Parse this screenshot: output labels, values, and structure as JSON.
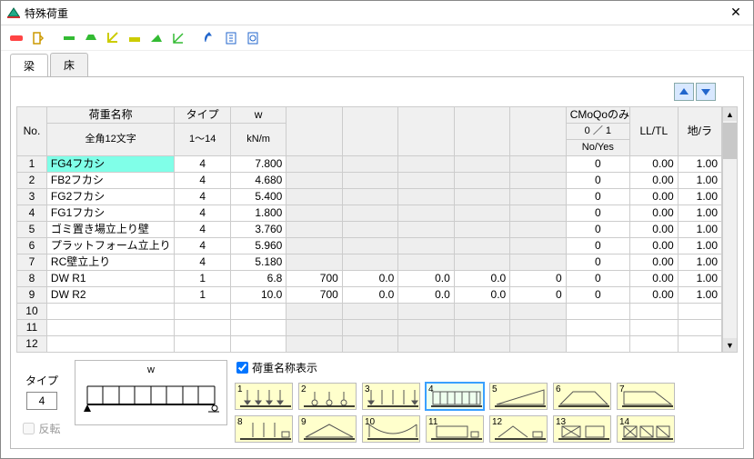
{
  "window": {
    "title": "特殊荷重"
  },
  "tabs": {
    "beam": "梁",
    "floor": "床"
  },
  "header": {
    "no": "No.",
    "name": "荷重名称",
    "name_sub": "全角12文字",
    "type": "タイプ",
    "type_sub": "1～14",
    "w": "w",
    "w_sub": "kN/m",
    "cmoqo": "CMoQoのみ",
    "cmoqo_sub1": "0 ／ 1",
    "cmoqo_sub2": "No/Yes",
    "lltl": "LL/TL",
    "jira": "地/ラ"
  },
  "rows": [
    {
      "no": 1,
      "name": "FG4フカシ",
      "type": 4,
      "w": "7.800",
      "hl": true,
      "g": [
        "",
        "",
        "",
        "",
        ""
      ],
      "cm": 0,
      "ll": "0.00",
      "ji": "1.00"
    },
    {
      "no": 2,
      "name": "FB2フカシ",
      "type": 4,
      "w": "4.680",
      "g": [
        "",
        "",
        "",
        "",
        ""
      ],
      "cm": 0,
      "ll": "0.00",
      "ji": "1.00"
    },
    {
      "no": 3,
      "name": "FG2フカシ",
      "type": 4,
      "w": "5.400",
      "g": [
        "",
        "",
        "",
        "",
        ""
      ],
      "cm": 0,
      "ll": "0.00",
      "ji": "1.00"
    },
    {
      "no": 4,
      "name": "FG1フカシ",
      "type": 4,
      "w": "1.800",
      "g": [
        "",
        "",
        "",
        "",
        ""
      ],
      "cm": 0,
      "ll": "0.00",
      "ji": "1.00"
    },
    {
      "no": 5,
      "name": "ゴミ置き場立上り壁",
      "type": 4,
      "w": "3.760",
      "g": [
        "",
        "",
        "",
        "",
        ""
      ],
      "cm": 0,
      "ll": "0.00",
      "ji": "1.00"
    },
    {
      "no": 6,
      "name": "プラットフォーム立上り",
      "type": 4,
      "w": "5.960",
      "g": [
        "",
        "",
        "",
        "",
        ""
      ],
      "cm": 0,
      "ll": "0.00",
      "ji": "1.00"
    },
    {
      "no": 7,
      "name": "RC壁立上り",
      "type": 4,
      "w": "5.180",
      "g": [
        "",
        "",
        "",
        "",
        ""
      ],
      "cm": 0,
      "ll": "0.00",
      "ji": "1.00"
    },
    {
      "no": 8,
      "name": "DW R1",
      "type": 1,
      "w": "6.8",
      "g": [
        "700",
        "0.0",
        "0.0",
        "0.0",
        "0"
      ],
      "open": true,
      "cm": 0,
      "ll": "0.00",
      "ji": "1.00"
    },
    {
      "no": 9,
      "name": "DW R2",
      "type": 1,
      "w": "10.0",
      "g": [
        "700",
        "0.0",
        "0.0",
        "0.0",
        "0"
      ],
      "open": true,
      "cm": 0,
      "ll": "0.00",
      "ji": "1.00"
    },
    {
      "no": 10,
      "name": "",
      "type": "",
      "w": "",
      "g": [
        "",
        "",
        "",
        "",
        ""
      ],
      "cm": "",
      "ll": "",
      "ji": ""
    },
    {
      "no": 11,
      "name": "",
      "type": "",
      "w": "",
      "g": [
        "",
        "",
        "",
        "",
        ""
      ],
      "cm": "",
      "ll": "",
      "ji": ""
    },
    {
      "no": 12,
      "name": "",
      "type": "",
      "w": "",
      "g": [
        "",
        "",
        "",
        "",
        ""
      ],
      "cm": "",
      "ll": "",
      "ji": ""
    }
  ],
  "bottom": {
    "type_label": "タイプ",
    "type_value": "4",
    "flip_label": "反転",
    "preview_w": "w",
    "show_name_label": "荷重名称表示",
    "show_name_checked": true
  },
  "shapes": {
    "count": 14,
    "selected": 4
  }
}
